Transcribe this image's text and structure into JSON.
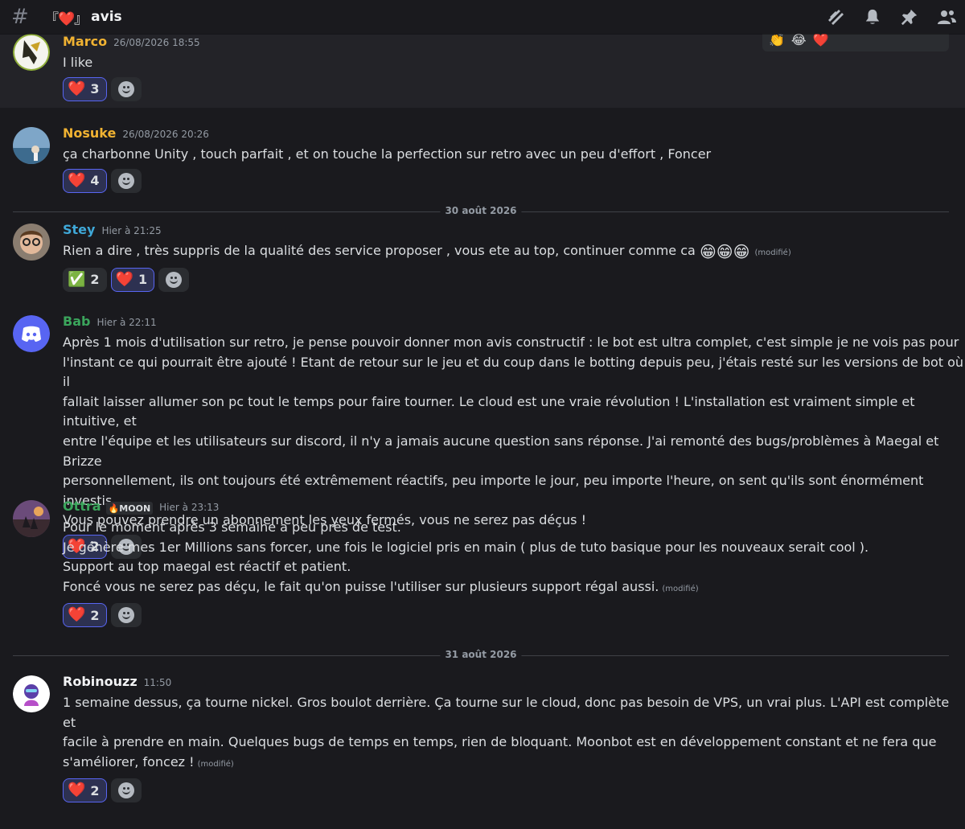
{
  "channel": {
    "icon": "#",
    "emoji": "『❤️』",
    "name": "avis"
  },
  "header_icons": [
    "threads-icon",
    "bell-icon",
    "pin-icon",
    "members-icon"
  ],
  "hover_toolbar": {
    "emojis": [
      "👏",
      "😂",
      "❤️"
    ]
  },
  "colors": {
    "yellow_name": "#f0b232",
    "blue_name": "#3fa8d8",
    "green_name": "#3ba55c",
    "accent": "#5865f2"
  },
  "messages": [
    {
      "author": "Marco",
      "timestamp": "26/08/2026 18:55",
      "lines": [
        "I like"
      ],
      "reactions": [
        {
          "emoji": "❤️",
          "count": "3",
          "me": true
        }
      ]
    },
    {
      "author": "Nosuke",
      "timestamp": "26/08/2026 20:26",
      "lines": [
        "ça charbonne Unity , touch parfait , et on touche la perfection sur retro avec un peu d'effort , Foncer"
      ],
      "reactions": [
        {
          "emoji": "❤️",
          "count": "4",
          "me": true
        }
      ]
    },
    {
      "author": "Stey",
      "timestamp": "Hier à 21:25",
      "lines": [
        "Rien a dire , très suppris de la qualité des service proposer  , vous ete au top, continuer comme ca"
      ],
      "trailing_emoji": "😁😁😁",
      "edited": "(modifié)",
      "reactions": [
        {
          "emoji": "✅",
          "count": "2",
          "me": false
        },
        {
          "emoji": "❤️",
          "count": "1",
          "me": true
        }
      ]
    },
    {
      "author": "Bab",
      "timestamp": "Hier à 22:11",
      "lines": [
        "Après 1 mois d'utilisation sur retro, je pense pouvoir donner mon avis constructif : le bot est ultra complet, c'est simple je ne vois pas pour",
        "l'instant ce qui pourrait être ajouté ! Etant de retour sur le jeu et du coup dans le botting depuis peu, j'étais resté sur les versions de bot où il",
        "fallait laisser allumer son pc tout le temps pour faire tourner. Le cloud est une vraie révolution !  L'installation est vraiment simple et intuitive, et",
        "entre l'équipe et les utilisateurs sur discord, il n'y a jamais aucune question sans réponse. J'ai remonté des bugs/problèmes à Maegal et Brizze",
        "personnellement, ils ont toujours été extrêmement réactifs, peu importe le jour, peu importe l'heure, on sent qu'ils sont énormément investis.",
        "Vous pouvez prendre un abonnement les yeux fermés, vous ne serez pas déçus !"
      ],
      "reactions": [
        {
          "emoji": "❤️",
          "count": "2",
          "me": true
        }
      ]
    },
    {
      "author": "Ottra",
      "badge": "🔥MOON",
      "timestamp": "Hier à 23:13",
      "lines": [
        "Pour le moment après 3 semaine a peu près de test.",
        "Je génère mes 1er Millions sans forcer, une fois le logiciel pris en main ( plus de tuto basique pour les nouveaux serait cool ).",
        "Support au top maegal est réactif et patient.",
        "Foncé vous ne serez pas déçu, le fait qu'on puisse l'utiliser sur plusieurs support régal aussi."
      ],
      "edited": "(modifié)",
      "reactions": [
        {
          "emoji": "❤️",
          "count": "2",
          "me": true
        }
      ]
    },
    {
      "author": "Robinouzz",
      "timestamp": "11:50",
      "lines": [
        "1 semaine dessus, ça tourne nickel. Gros boulot derrière. Ça tourne sur le cloud, donc pas besoin de VPS, un vrai plus. L'API est complète et",
        "facile à prendre en main. Quelques bugs de temps en temps, rien de bloquant. Moonbot est en développement constant et ne fera que",
        "s'améliorer, foncez !"
      ],
      "edited": "(modifié)",
      "reactions": [
        {
          "emoji": "❤️",
          "count": "2",
          "me": true
        }
      ]
    }
  ],
  "dividers": [
    "30 août 2026",
    "31 août 2026"
  ]
}
